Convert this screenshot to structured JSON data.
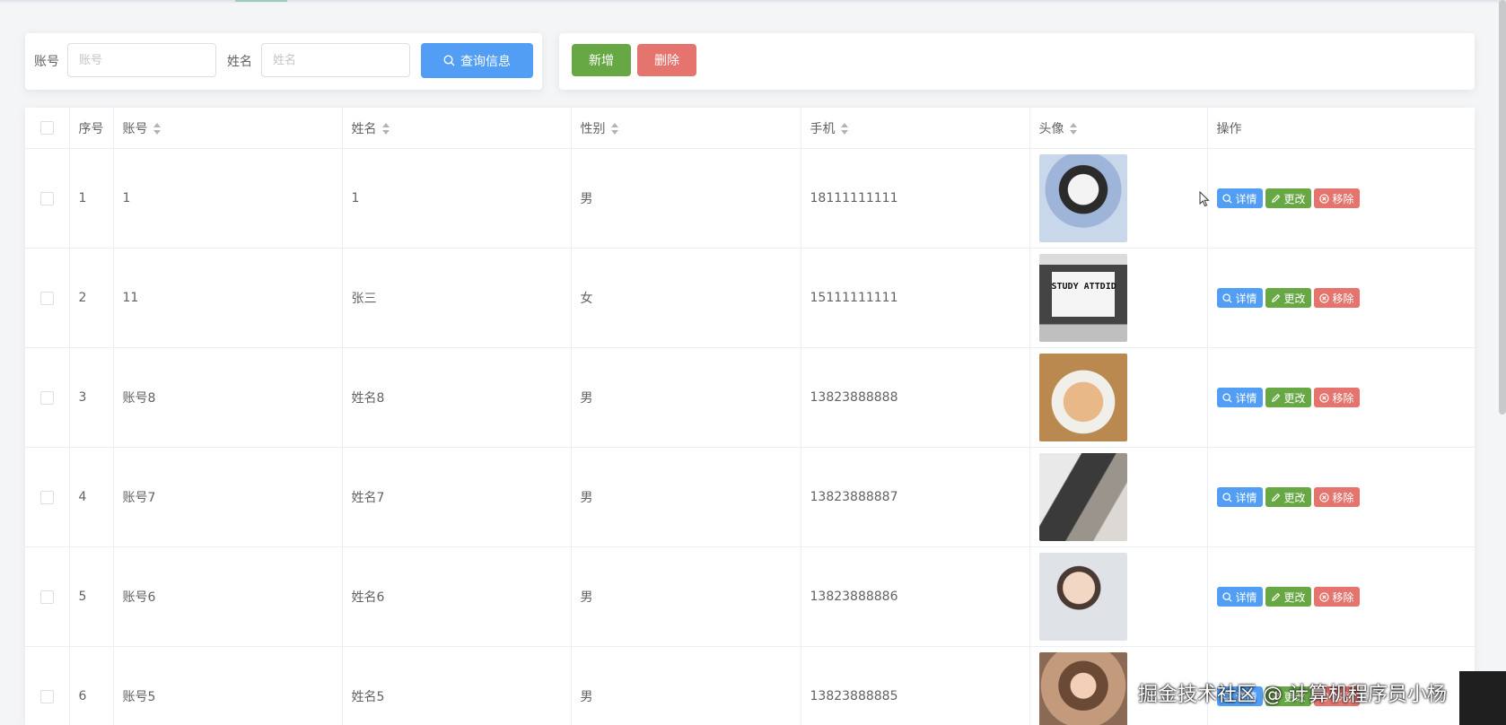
{
  "search": {
    "account_label": "账号",
    "account_placeholder": "账号",
    "name_label": "姓名",
    "name_placeholder": "姓名",
    "search_button": "查询信息"
  },
  "actions": {
    "add_button": "新增",
    "delete_button": "删除"
  },
  "table": {
    "headers": {
      "index": "序号",
      "account": "账号",
      "name": "姓名",
      "gender": "性别",
      "phone": "手机",
      "avatar": "头像",
      "operation": "操作"
    },
    "row_buttons": {
      "detail": "详情",
      "edit": "更改",
      "remove": "移除"
    },
    "rows": [
      {
        "index": "1",
        "account": "1",
        "name": "1",
        "gender": "男",
        "phone": "18111111111"
      },
      {
        "index": "2",
        "account": "11",
        "name": "张三",
        "gender": "女",
        "phone": "15111111111",
        "avatar_text": "STUDY ATTDID"
      },
      {
        "index": "3",
        "account": "账号8",
        "name": "姓名8",
        "gender": "男",
        "phone": "13823888888"
      },
      {
        "index": "4",
        "account": "账号7",
        "name": "姓名7",
        "gender": "男",
        "phone": "13823888887"
      },
      {
        "index": "5",
        "account": "账号6",
        "name": "姓名6",
        "gender": "男",
        "phone": "13823888886"
      },
      {
        "index": "6",
        "account": "账号5",
        "name": "姓名5",
        "gender": "男",
        "phone": "13823888885"
      }
    ]
  },
  "watermark": "掘金技术社区 @ 计算机程序员小杨",
  "colors": {
    "primary": "#529ef5",
    "success": "#67a844",
    "danger": "#e4746d"
  },
  "icons": [
    "search-icon",
    "edit-icon",
    "remove-icon",
    "sort-icon",
    "cursor-icon"
  ]
}
